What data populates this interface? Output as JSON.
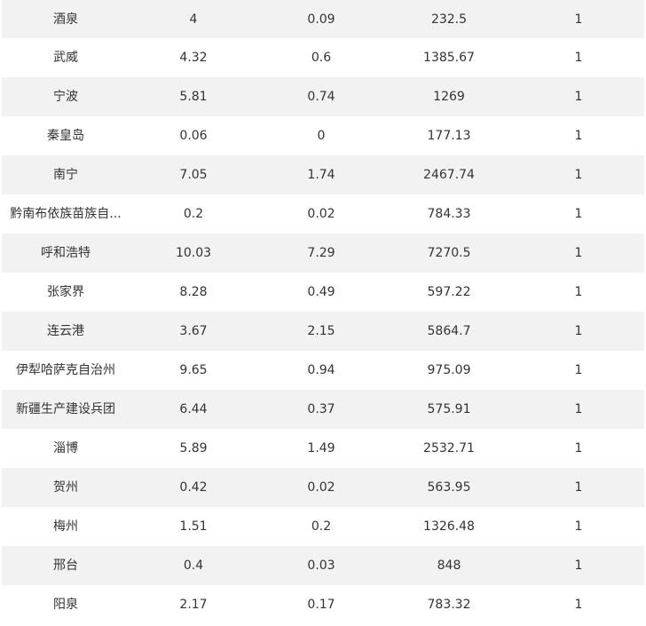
{
  "table": {
    "rows": [
      {
        "name": "酒泉",
        "v1": "4",
        "v2": "0.09",
        "v3": "232.5",
        "v4": "1"
      },
      {
        "name": "武威",
        "v1": "4.32",
        "v2": "0.6",
        "v3": "1385.67",
        "v4": "1"
      },
      {
        "name": "宁波",
        "v1": "5.81",
        "v2": "0.74",
        "v3": "1269",
        "v4": "1"
      },
      {
        "name": "秦皇岛",
        "v1": "0.06",
        "v2": "0",
        "v3": "177.13",
        "v4": "1"
      },
      {
        "name": "南宁",
        "v1": "7.05",
        "v2": "1.74",
        "v3": "2467.74",
        "v4": "1"
      },
      {
        "name": "黔南布依族苗族自...",
        "v1": "0.2",
        "v2": "0.02",
        "v3": "784.33",
        "v4": "1"
      },
      {
        "name": "呼和浩特",
        "v1": "10.03",
        "v2": "7.29",
        "v3": "7270.5",
        "v4": "1"
      },
      {
        "name": "张家界",
        "v1": "8.28",
        "v2": "0.49",
        "v3": "597.22",
        "v4": "1"
      },
      {
        "name": "连云港",
        "v1": "3.67",
        "v2": "2.15",
        "v3": "5864.7",
        "v4": "1"
      },
      {
        "name": "伊犁哈萨克自治州",
        "v1": "9.65",
        "v2": "0.94",
        "v3": "975.09",
        "v4": "1"
      },
      {
        "name": "新疆生产建设兵团",
        "v1": "6.44",
        "v2": "0.37",
        "v3": "575.91",
        "v4": "1"
      },
      {
        "name": "淄博",
        "v1": "5.89",
        "v2": "1.49",
        "v3": "2532.71",
        "v4": "1"
      },
      {
        "name": "贺州",
        "v1": "0.42",
        "v2": "0.02",
        "v3": "563.95",
        "v4": "1"
      },
      {
        "name": "梅州",
        "v1": "1.51",
        "v2": "0.2",
        "v3": "1326.48",
        "v4": "1"
      },
      {
        "name": "邢台",
        "v1": "0.4",
        "v2": "0.03",
        "v3": "848",
        "v4": "1"
      },
      {
        "name": "阳泉",
        "v1": "2.17",
        "v2": "0.17",
        "v3": "783.32",
        "v4": "1"
      }
    ]
  },
  "colors": {
    "stripe": "#f2f2f2",
    "text": "#333333"
  }
}
